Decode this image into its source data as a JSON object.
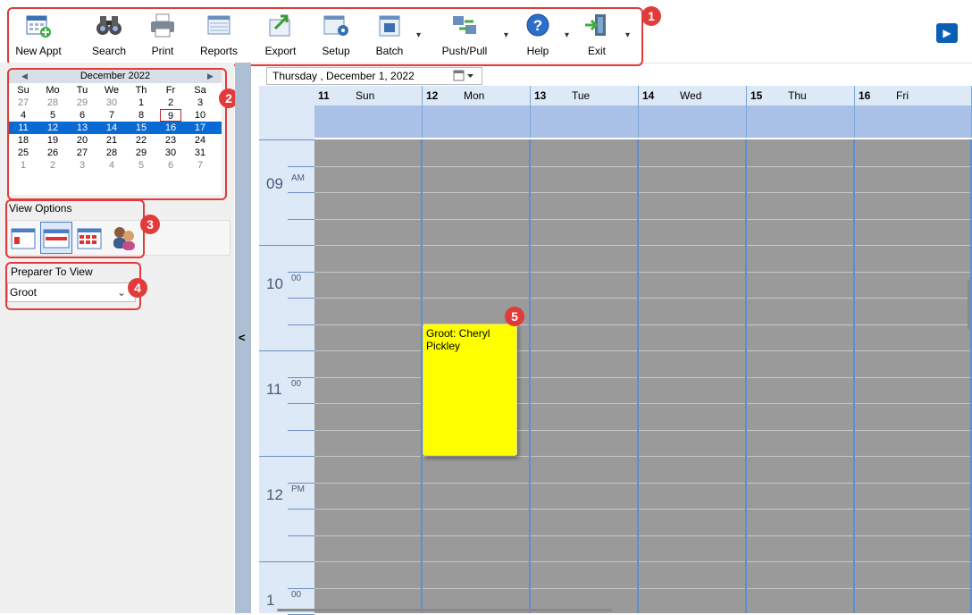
{
  "toolbar": {
    "items": [
      {
        "label": "New Appt",
        "icon": "new-appt-icon"
      },
      {
        "label": "Search",
        "icon": "binoculars-icon"
      },
      {
        "label": "Print",
        "icon": "printer-icon"
      },
      {
        "label": "Reports",
        "icon": "reports-icon"
      },
      {
        "label": "Export",
        "icon": "export-icon"
      },
      {
        "label": "Setup",
        "icon": "setup-icon"
      },
      {
        "label": "Batch",
        "icon": "batch-icon"
      },
      {
        "label": "Push/Pull",
        "icon": "push-pull-icon"
      },
      {
        "label": "Help",
        "icon": "help-icon"
      },
      {
        "label": "Exit",
        "icon": "exit-icon"
      }
    ],
    "dropdown_glyph": "▾",
    "play_glyph": "▶"
  },
  "badges": [
    "1",
    "2",
    "3",
    "4",
    "5"
  ],
  "calendar": {
    "month_label": "December 2022",
    "prev_glyph": "◀",
    "next_glyph": "▶",
    "dow": [
      "Su",
      "Mo",
      "Tu",
      "We",
      "Th",
      "Fr",
      "Sa"
    ],
    "weeks": [
      [
        "27",
        "28",
        "29",
        "30",
        "1",
        "2",
        "3"
      ],
      [
        "4",
        "5",
        "6",
        "7",
        "8",
        "9",
        "10"
      ],
      [
        "11",
        "12",
        "13",
        "14",
        "15",
        "16",
        "17"
      ],
      [
        "18",
        "19",
        "20",
        "21",
        "22",
        "23",
        "24"
      ],
      [
        "25",
        "26",
        "27",
        "28",
        "29",
        "30",
        "31"
      ],
      [
        "1",
        "2",
        "3",
        "4",
        "5",
        "6",
        "7"
      ]
    ],
    "selected_week_index": 2,
    "today": "9"
  },
  "view_options": {
    "label": "View Options"
  },
  "preparer": {
    "label": "Preparer To View",
    "selected": "Groot"
  },
  "collapse_glyph": "<",
  "date_field": {
    "value": "Thursday  , December   1, 2022"
  },
  "days": [
    {
      "num": "11",
      "name": "Sun"
    },
    {
      "num": "12",
      "name": "Mon"
    },
    {
      "num": "13",
      "name": "Tue"
    },
    {
      "num": "14",
      "name": "Wed"
    },
    {
      "num": "15",
      "name": "Thu"
    },
    {
      "num": "16",
      "name": "Fri"
    }
  ],
  "times": [
    {
      "hour": "09",
      "sub": "AM"
    },
    {
      "hour": "10",
      "sub": "00"
    },
    {
      "hour": "11",
      "sub": "00"
    },
    {
      "hour": "12",
      "sub": "PM"
    },
    {
      "hour": "1",
      "sub": "00"
    }
  ],
  "appointment": {
    "text": "Groot: Cheryl Pickley"
  },
  "colors": {
    "callout": "#e23b3b",
    "selected_week": "#0a6ad4",
    "appointment": "#ffff00",
    "grid_body": "#9a9a9a",
    "header_blue": "#dde9f7"
  }
}
